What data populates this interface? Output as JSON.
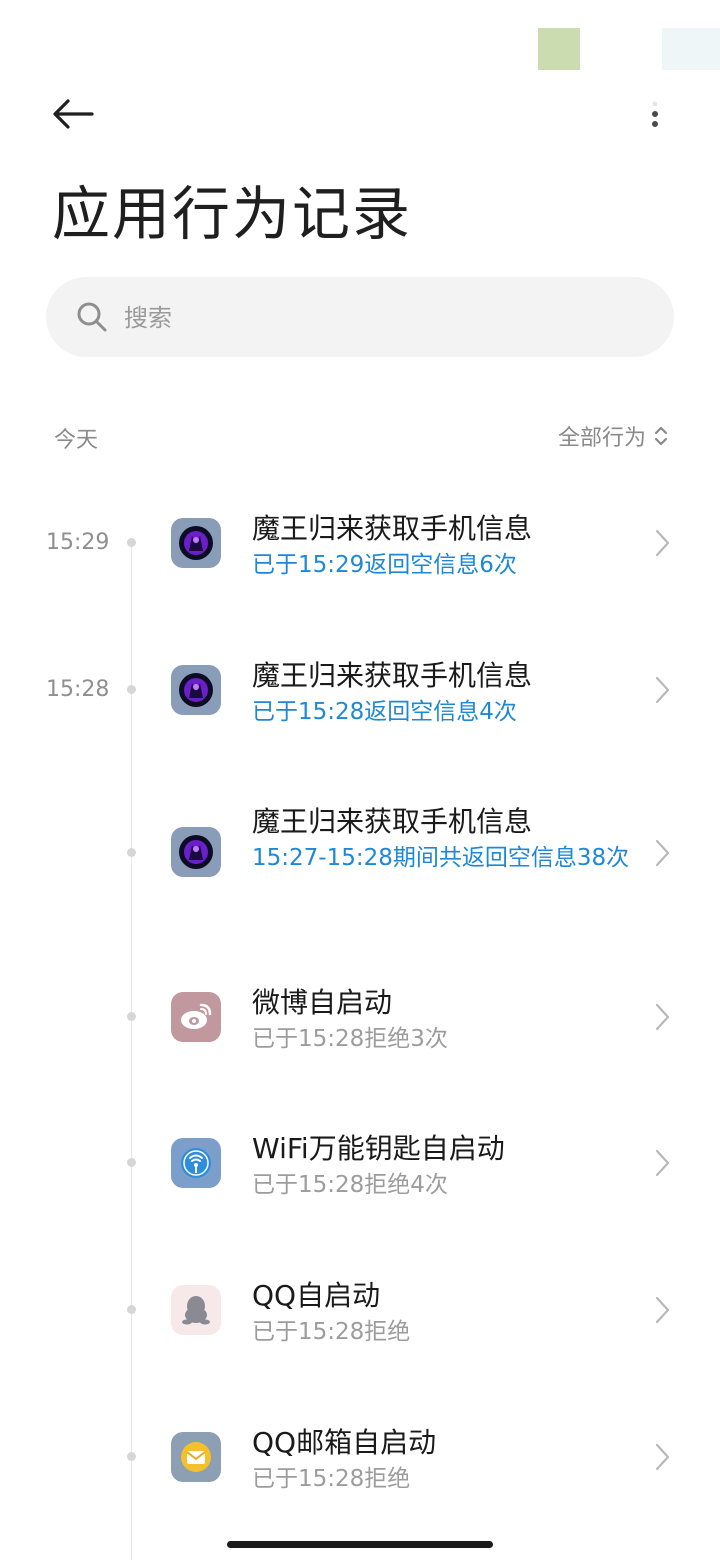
{
  "header": {
    "title": "应用行为记录"
  },
  "search": {
    "placeholder": "搜索"
  },
  "section": {
    "date_label": "今天",
    "filter_label": "全部行为"
  },
  "records": [
    {
      "time": "15:29",
      "title": "魔王归来获取手机信息",
      "detail": "已于15:29返回空信息6次",
      "icon": "demon-game-icon"
    },
    {
      "time": "15:28",
      "title": "魔王归来获取手机信息",
      "detail": "已于15:28返回空信息4次",
      "icon": "demon-game-icon"
    },
    {
      "time": "",
      "title": "魔王归来获取手机信息",
      "detail": "15:27-15:28期间共返回空信息38次",
      "icon": "demon-game-icon"
    },
    {
      "time": "",
      "title": "微博自启动",
      "detail": "已于15:28拒绝3次",
      "icon": "weibo-icon"
    },
    {
      "time": "",
      "title": "WiFi万能钥匙自启动",
      "detail": "已于15:28拒绝4次",
      "icon": "wifi-key-icon"
    },
    {
      "time": "",
      "title": "QQ自启动",
      "detail": "已于15:28拒绝",
      "icon": "qq-penguin-icon"
    },
    {
      "time": "",
      "title": "QQ邮箱自启动",
      "detail": "已于15:28拒绝",
      "icon": "qq-mail-icon"
    }
  ],
  "colors": {
    "accent_blue": "#1e88d6",
    "muted_gray": "#9c9c9c"
  }
}
